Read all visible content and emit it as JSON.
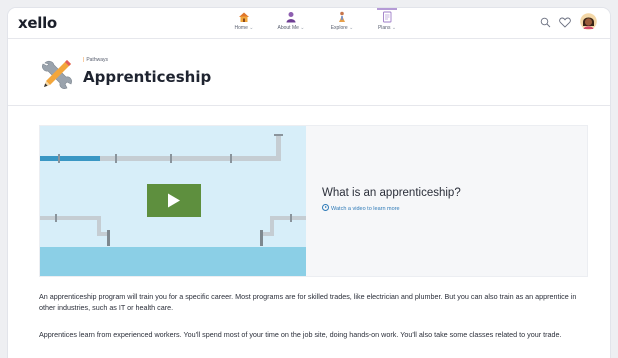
{
  "app": {
    "logo": "xello"
  },
  "nav": {
    "items": [
      {
        "label": "Home",
        "icon": "home-icon"
      },
      {
        "label": "About Me",
        "icon": "person-icon"
      },
      {
        "label": "Explore",
        "icon": "explore-icon"
      },
      {
        "label": "Plans",
        "icon": "plans-icon"
      }
    ],
    "active": "Plans",
    "right_icons": [
      "search-icon",
      "heart-icon",
      "avatar"
    ]
  },
  "header": {
    "breadcrumb": "Pathways",
    "title": "Apprenticeship",
    "icon": "tools-icon"
  },
  "video": {
    "title": "What is an apprenticeship?",
    "link": "Watch a video to learn more"
  },
  "body": {
    "paragraph1": "An apprenticeship program will train you for a specific career. Most programs are for skilled trades, like electrician and plumber. But you can also train as an apprentice in other industries, such as IT or health care.",
    "paragraph2": "Apprentices learn from experienced workers. You'll spend most of your time on the job site, doing hands-on work. You'll also take some classes related to your trade."
  },
  "colors": {
    "accent_purple": "#b59bd6",
    "play_green": "#5e8f3e",
    "link_blue": "#2f7bb8",
    "thumb_sky": "#d7eef9",
    "thumb_water": "#8bcfe6"
  }
}
